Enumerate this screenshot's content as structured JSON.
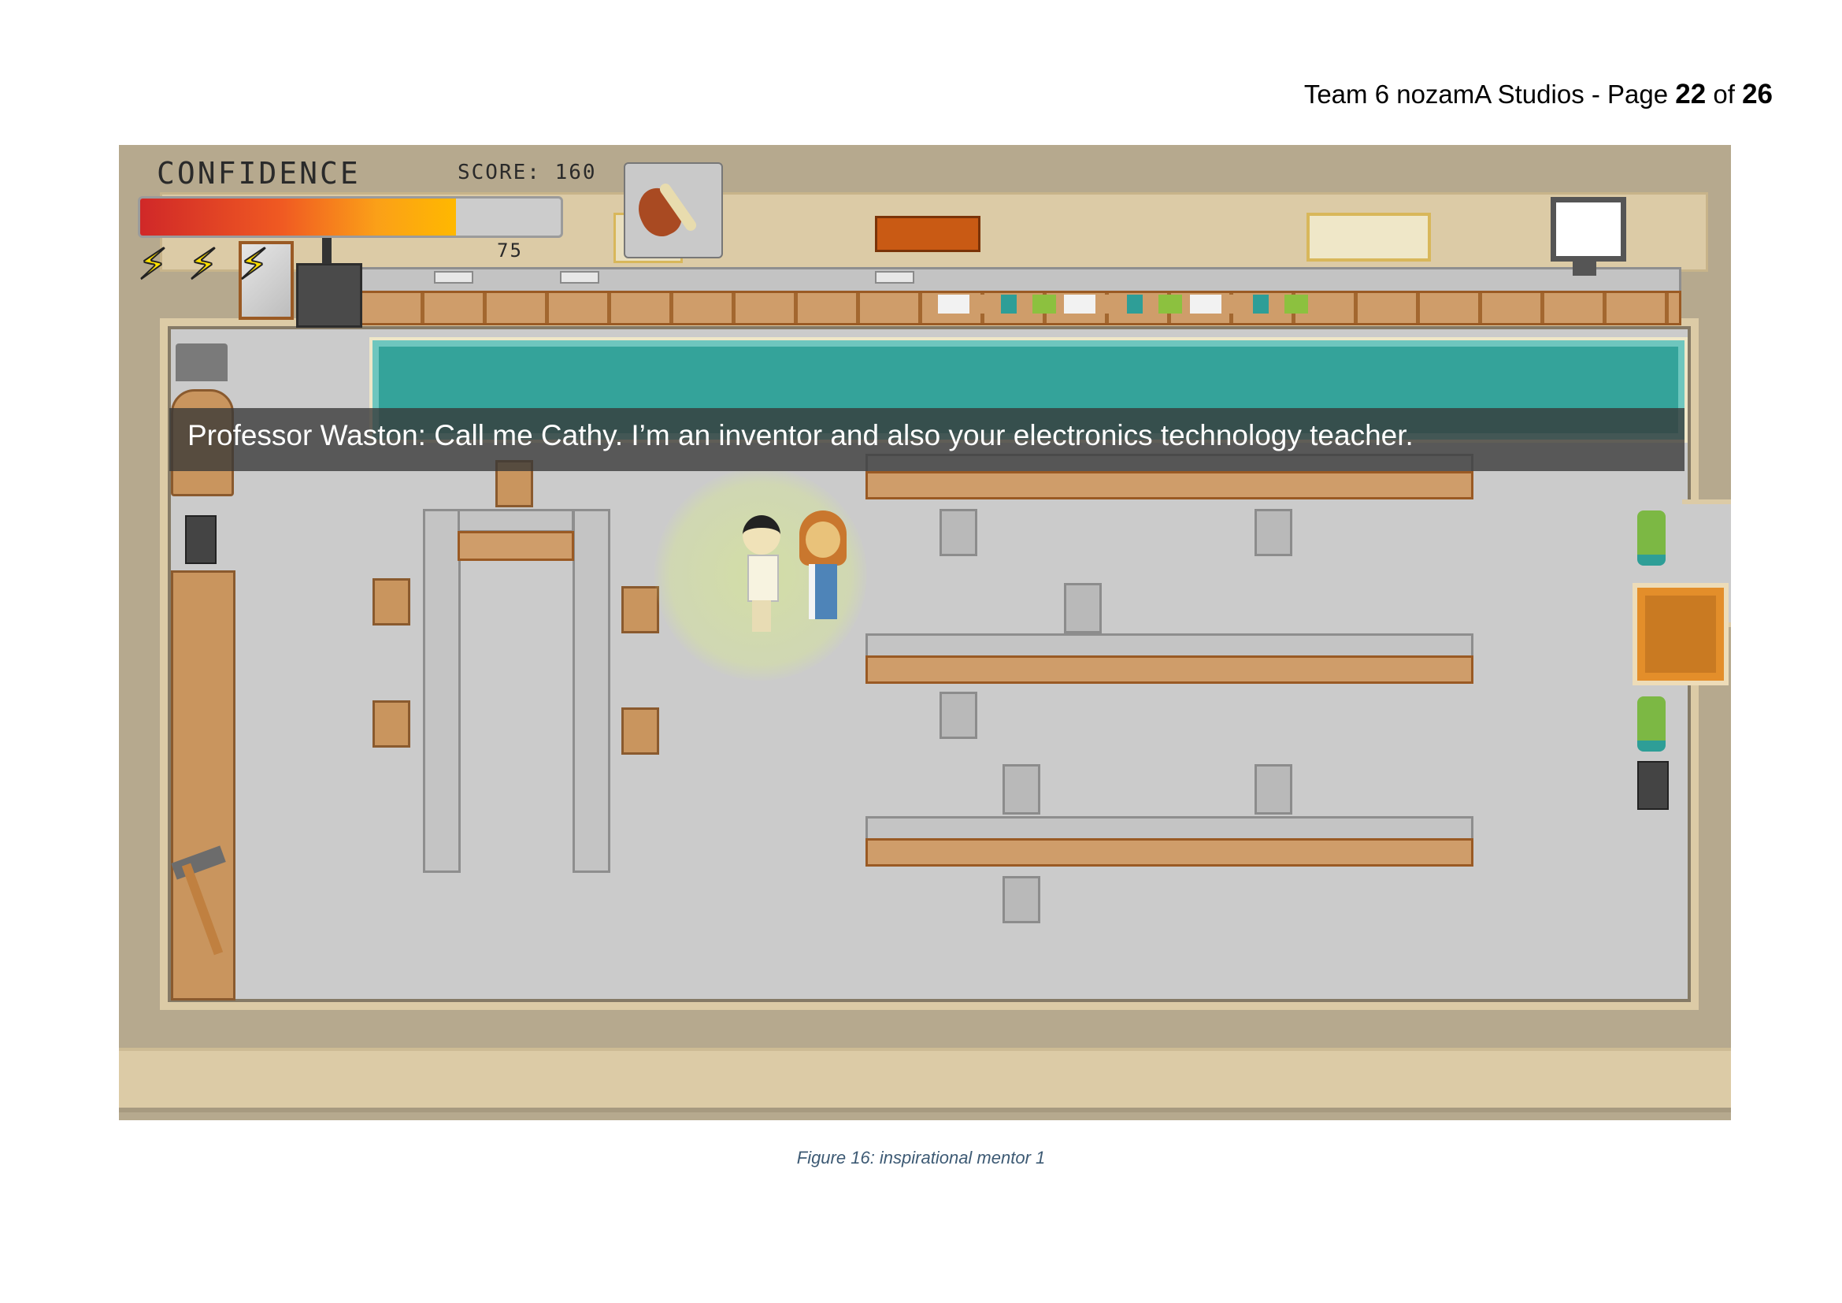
{
  "header": {
    "team": "Team 6 nozamA Studios - Page ",
    "page_current": "22",
    "of_label": " of ",
    "page_total": "26"
  },
  "hud": {
    "confidence_label": "CONFIDENCE",
    "score_label": "SCORE: 160",
    "confidence_value": "75",
    "confidence_fraction": 0.75,
    "lives_icons": [
      "lightning-bolt-icon",
      "lightning-bolt-icon",
      "lightning-bolt-icon"
    ],
    "held_item_icon": "chicken-drumstick-icon"
  },
  "dialog": {
    "text": "Professor Waston: Call me Cathy. I’m an inventor and also your electronics technology teacher."
  },
  "caption": "Figure 16: inspirational mentor 1",
  "colors": {
    "floor": "#cbcbcb",
    "wall": "#dccba6",
    "outer": "#b6a98e",
    "pool": "#34a39a",
    "wood": "#c9955e"
  }
}
